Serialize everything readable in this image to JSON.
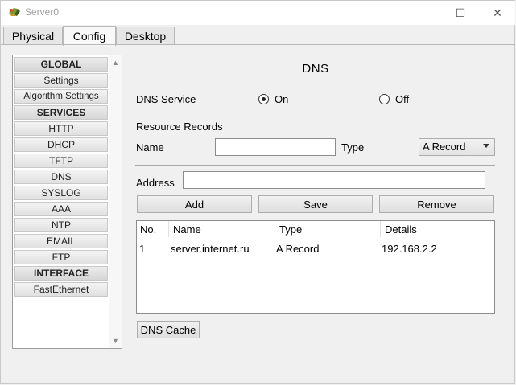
{
  "window": {
    "title": "Server0",
    "controls": {
      "minimize": "—",
      "maximize": "☐",
      "close": "✕"
    }
  },
  "tabs": [
    {
      "label": "Physical",
      "active": false
    },
    {
      "label": "Config",
      "active": true
    },
    {
      "label": "Desktop",
      "active": false
    }
  ],
  "sidebar": {
    "items": [
      {
        "label": "GLOBAL",
        "header": true
      },
      {
        "label": "Settings"
      },
      {
        "label": "Algorithm Settings"
      },
      {
        "label": "SERVICES",
        "header": true
      },
      {
        "label": "HTTP"
      },
      {
        "label": "DHCP"
      },
      {
        "label": "TFTP"
      },
      {
        "label": "DNS"
      },
      {
        "label": "SYSLOG"
      },
      {
        "label": "AAA"
      },
      {
        "label": "NTP"
      },
      {
        "label": "EMAIL"
      },
      {
        "label": "FTP"
      },
      {
        "label": "INTERFACE",
        "header": true
      },
      {
        "label": "FastEthernet"
      }
    ],
    "scroll_up": "▲",
    "scroll_down": "▼"
  },
  "dns": {
    "heading": "DNS",
    "service_label": "DNS Service",
    "on_label": "On",
    "off_label": "Off",
    "service_on": true,
    "records_label": "Resource Records",
    "name_label": "Name",
    "name_value": "",
    "type_label": "Type",
    "type_value": "A Record",
    "address_label": "Address",
    "address_value": "",
    "buttons": {
      "add": "Add",
      "save": "Save",
      "remove": "Remove"
    },
    "table": {
      "columns": [
        "No.",
        "Name",
        "Type",
        "Details"
      ],
      "rows": [
        [
          "1",
          "server.internet.ru",
          "A Record",
          "192.168.2.2"
        ]
      ]
    },
    "cache_button": "DNS Cache"
  }
}
